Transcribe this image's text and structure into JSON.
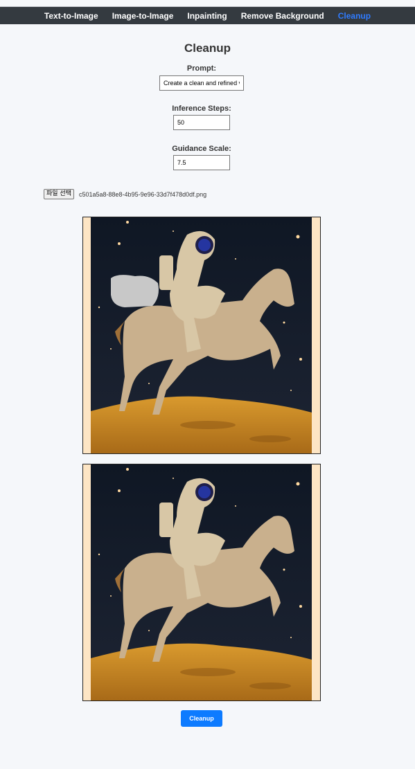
{
  "nav": {
    "items": [
      {
        "label": "Text-to-Image"
      },
      {
        "label": "Image-to-Image"
      },
      {
        "label": "Inpainting"
      },
      {
        "label": "Remove Background"
      },
      {
        "label": "Cleanup"
      }
    ],
    "active_index": 4,
    "active_color": "#2f7bff",
    "bar_color": "#343a40"
  },
  "page": {
    "title": "Cleanup"
  },
  "form": {
    "prompt_label": "Prompt:",
    "prompt_value": "Create a clean and refined v",
    "steps_label": "Inference Steps:",
    "steps_value": "50",
    "guidance_label": "Guidance Scale:",
    "guidance_value": "7.5",
    "file_button_label": "파일 선택",
    "file_name": "c501a5a8-88e8-4b95-9e96-33d7f478d0df.png",
    "submit_label": "Cleanup",
    "submit_color": "#0d7bff"
  },
  "images": {
    "input_description_icon": "astronaut-horse-image-masked",
    "output_description_icon": "astronaut-horse-image-cleaned"
  }
}
